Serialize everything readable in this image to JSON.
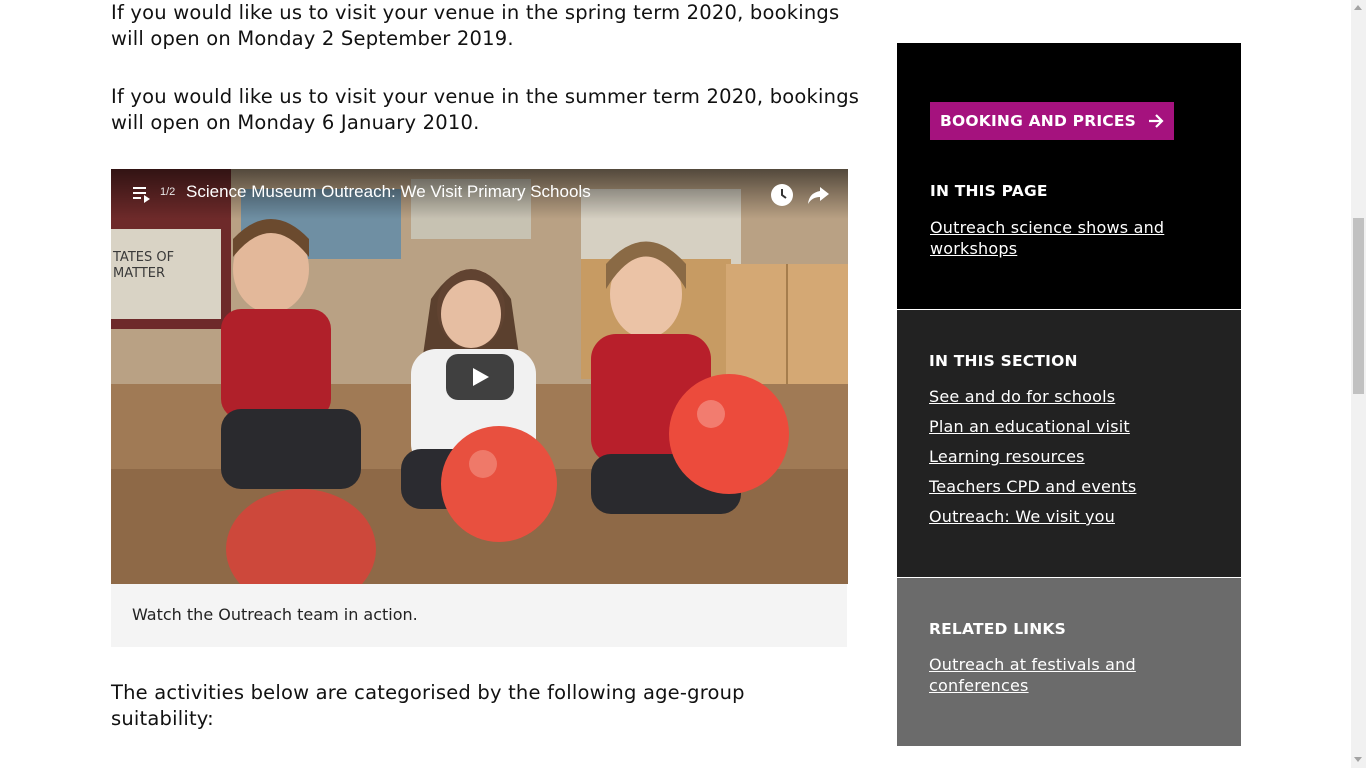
{
  "main": {
    "paragraph_spring": "If you would like us to visit your venue in the spring term 2020, bookings will open on Monday 2 September 2019.",
    "paragraph_summer": "If you would like us to visit your venue in the summer term 2020, bookings will open on Monday 6 January 2010.",
    "video": {
      "playlist_count": "1/2",
      "title": "Science Museum Outreach: We Visit Primary Schools",
      "caption": "Watch the Outreach team in action.",
      "icons": [
        "playlist-icon",
        "watch-later-icon",
        "share-icon",
        "play-icon"
      ]
    },
    "paragraph_activities": "The activities below are categorised by the following age-group suitability:"
  },
  "sidebar": {
    "booking_button_label": "BOOKING AND PRICES",
    "in_this_page": {
      "heading": "IN THIS PAGE",
      "links": [
        "Outreach science shows and workshops"
      ]
    },
    "in_this_section": {
      "heading": "IN THIS SECTION",
      "links": [
        "See and do for schools",
        "Plan an educational visit",
        "Learning resources",
        "Teachers CPD and events",
        "Outreach: We visit you"
      ]
    },
    "related_links": {
      "heading": "RELATED LINKS",
      "links": [
        "Outreach at festivals and conferences"
      ]
    }
  },
  "colors": {
    "accent": "#a5127e",
    "panel_page_bg": "#000000",
    "panel_section_bg": "#222222",
    "panel_related_bg": "#6b6b6b"
  }
}
